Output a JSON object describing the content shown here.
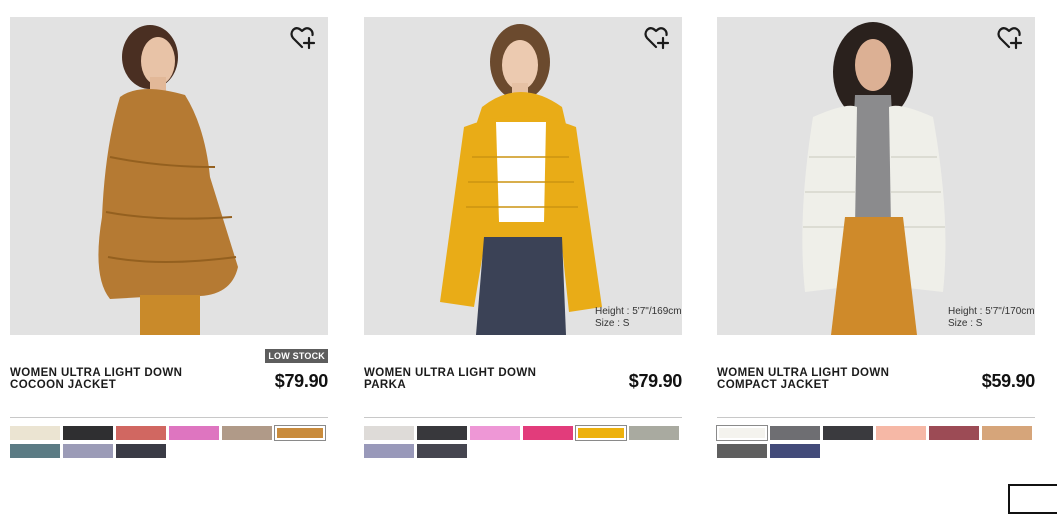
{
  "colors": {
    "photo_background": "#e2e2e2",
    "badge_background": "#5d5d5d",
    "divider": "#c8c8c8"
  },
  "products": [
    {
      "title": "WOMEN ULTRA LIGHT DOWN COCOON JACKET",
      "price": "$79.90",
      "badge": "LOW STOCK",
      "wishlist_icon": "heart-plus-icon",
      "model_height": "",
      "model_size": "",
      "jacket_color": "#b57a33",
      "swatches": [
        "#ebe4d2",
        "#2f2f31",
        "#d16761",
        "#de75c0",
        "#b09a88",
        "#c98b3c",
        "#5b7b84",
        "#9b9bb7",
        "#3a3b45"
      ],
      "selected_swatch": 5
    },
    {
      "title": "WOMEN ULTRA LIGHT DOWN PARKA",
      "price": "$79.90",
      "badge": "",
      "wishlist_icon": "heart-plus-icon",
      "model_height": "Height : 5'7\"/169cm",
      "model_size": "Size : S",
      "jacket_color": "#e9ac17",
      "swatches": [
        "#dedbd8",
        "#38383c",
        "#ee97d6",
        "#e23c7b",
        "#edb10d",
        "#a9aaa0",
        "#9999ba",
        "#45454f"
      ],
      "selected_swatch": 4
    },
    {
      "title": "WOMEN ULTRA LIGHT DOWN COMPACT JACKET",
      "price": "$59.90",
      "badge": "",
      "wishlist_icon": "heart-plus-icon",
      "model_height": "Height : 5'7\"/170cm",
      "model_size": "Size : S",
      "jacket_color": "#efefe9",
      "swatches": [
        "#f4f3ee",
        "#6e6e72",
        "#3a3a3e",
        "#f6b8a6",
        "#9c4b55",
        "#d6a57a",
        "#5f5f5f",
        "#434b7a"
      ],
      "selected_swatch": 0
    }
  ]
}
